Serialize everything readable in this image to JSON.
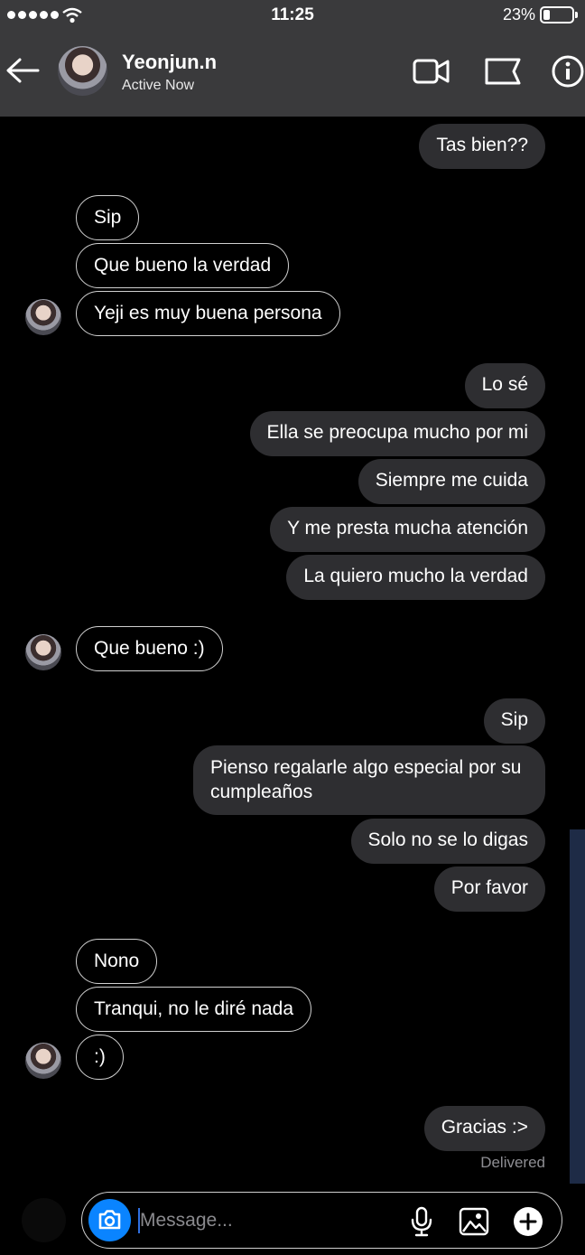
{
  "status_bar": {
    "time": "11:25",
    "battery": "23%",
    "battery_level": 0.23
  },
  "header": {
    "name": "Yeonjun.n",
    "status": "Active Now"
  },
  "messages": [
    {
      "text": "Tas bien??"
    },
    {
      "text": "Sip"
    },
    {
      "text": "Que bueno la verdad"
    },
    {
      "text": "Yeji es muy buena persona"
    },
    {
      "text": "Lo sé"
    },
    {
      "text": "Ella se preocupa mucho por mi"
    },
    {
      "text": "Siempre me cuida"
    },
    {
      "text": "Y me presta mucha atención"
    },
    {
      "text": "La quiero mucho la verdad"
    },
    {
      "text": "Que bueno :)"
    },
    {
      "text": "Sip"
    },
    {
      "text": "Pienso regalarle algo especial por su cumpleaños"
    },
    {
      "text": "Solo no se lo digas"
    },
    {
      "text": "Por favor"
    },
    {
      "text": "Nono"
    },
    {
      "text": "Tranqui, no le diré nada"
    },
    {
      "text": ":)"
    },
    {
      "text": "Gracias :>"
    }
  ],
  "delivered_label": "Delivered",
  "composer": {
    "placeholder": "Message..."
  },
  "icons": {
    "back": "back-arrow-icon",
    "video": "video-camera-icon",
    "flag": "flag-icon",
    "info": "info-icon",
    "camera": "camera-icon",
    "mic": "microphone-icon",
    "gallery": "image-icon",
    "add": "plus-icon"
  },
  "colors": {
    "background": "#000000",
    "header": "#3a3a3c",
    "outgoing_bubble": "#2e2e31",
    "incoming_border": "#d0d0d0",
    "accent": "#0a84ff"
  }
}
